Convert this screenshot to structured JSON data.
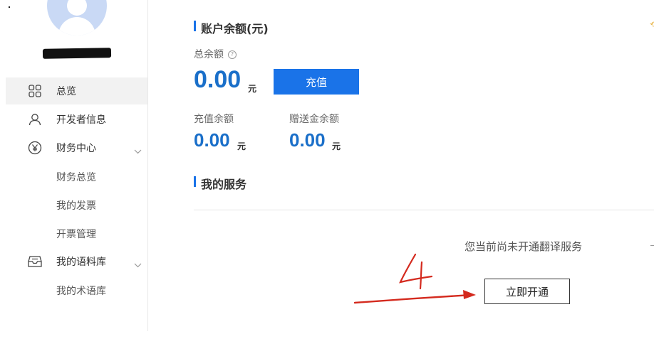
{
  "sidebar": {
    "items": [
      {
        "label": "总览",
        "icon": "grid-icon",
        "active": true
      },
      {
        "label": "开发者信息",
        "icon": "user-icon"
      },
      {
        "label": "财务中心",
        "icon": "yen-icon",
        "expandable": true
      },
      {
        "label": "我的语料库",
        "icon": "inbox-icon",
        "expandable": true
      }
    ],
    "finance_sub": [
      "财务总览",
      "我的发票",
      "开票管理"
    ],
    "corpus_sub": [
      "我的术语库"
    ]
  },
  "balance": {
    "title": "账户余额(元)",
    "total_label": "总余额",
    "total_value": "0.00",
    "unit": "元",
    "recharge_label": "充值",
    "recharge_balance_label": "充值余额",
    "recharge_balance_value": "0.00",
    "gift_balance_label": "赠送金余额",
    "gift_balance_value": "0.00"
  },
  "services": {
    "title": "我的服务",
    "empty_message": "您当前尚未开通翻译服务",
    "open_label": "立即开通"
  },
  "annotation": {
    "handwritten_number": "4",
    "color": "#d42a1e"
  },
  "colors": {
    "accent": "#1a73e8",
    "amount": "#1a6fc9"
  }
}
